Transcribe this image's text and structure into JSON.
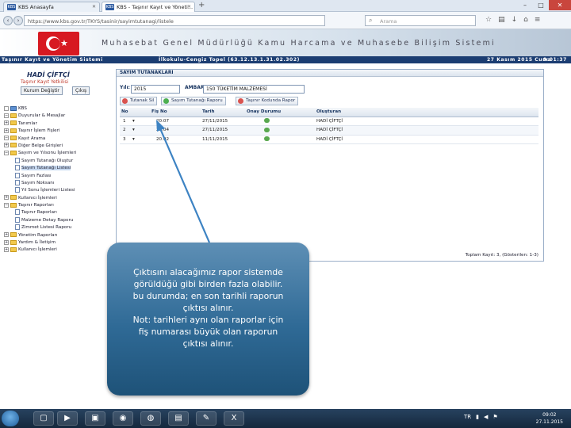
{
  "browser": {
    "tabs": [
      {
        "label": "KBS Anasayfa",
        "favicon": "KBS"
      },
      {
        "label": "KBS - Taşınır Kayıt ve Yöneti...",
        "favicon": "KBS"
      }
    ],
    "new_tab": "+",
    "url": "https://www.kbs.gov.tr/TKYS/tasinir/sayimtutanagi/listele",
    "search_placeholder": "Arama",
    "search_icon": "search-icon",
    "window_controls": {
      "minimize": "–",
      "maximize": "□",
      "close": "✕"
    }
  },
  "header": {
    "site_title": "Muhasebat Genel Müdürlüğü Kamu Harcama ve Muhasebe Bilişim Sistemi",
    "module": "Taşınır Kayıt ve Yönetim Sistemi",
    "unit": "İlkokulu-Cengiz Topel (63.12.13.1.31.02.302)",
    "date": "27 Kasım 2015 Cuma",
    "time": "9:01:37"
  },
  "user": {
    "name": "HADİ ÇİFTÇİ",
    "role": "Taşınır Kayıt Yetkilisi",
    "change_role": "Kurum Değiştir",
    "logout": "Çıkış"
  },
  "tree": [
    {
      "label": "KBS",
      "level": 0,
      "type": "root",
      "expander": ""
    },
    {
      "label": "Duyurular & Mesajlar",
      "level": 0,
      "type": "folder",
      "expander": "−"
    },
    {
      "label": "Tanımlar",
      "level": 0,
      "type": "folder",
      "expander": "+"
    },
    {
      "label": "Taşınır İşlem Fişleri",
      "level": 0,
      "type": "folder",
      "expander": "+"
    },
    {
      "label": "Kayıt Arama",
      "level": 0,
      "type": "folder",
      "expander": "−"
    },
    {
      "label": "Diğer Belge Girişleri",
      "level": 0,
      "type": "folder",
      "expander": "+"
    },
    {
      "label": "Sayım ve Yılsonu İşlemleri",
      "level": 0,
      "type": "folder",
      "expander": "−"
    },
    {
      "label": "Sayım Tutanağı Oluştur",
      "level": 1,
      "type": "doc",
      "expander": ""
    },
    {
      "label": "Sayım Tutanağı Listesi",
      "level": 1,
      "type": "doc",
      "expander": "",
      "selected": true
    },
    {
      "label": "Sayım Fazlası",
      "level": 1,
      "type": "doc",
      "expander": ""
    },
    {
      "label": "Sayım Noksanı",
      "level": 1,
      "type": "doc",
      "expander": ""
    },
    {
      "label": "Yıl Sonu İşlemleri Listesi",
      "level": 1,
      "type": "doc",
      "expander": ""
    },
    {
      "label": "Kullanıcı İşlemleri",
      "level": 0,
      "type": "folder",
      "expander": "+"
    },
    {
      "label": "Taşınır Raporları",
      "level": 0,
      "type": "folder",
      "expander": "−"
    },
    {
      "label": "Taşınır Raporları",
      "level": 1,
      "type": "doc",
      "expander": ""
    },
    {
      "label": "Malzeme Detay Raporu",
      "level": 1,
      "type": "doc",
      "expander": ""
    },
    {
      "label": "Zimmet Listesi Raporu",
      "level": 1,
      "type": "doc",
      "expander": ""
    },
    {
      "label": "Yönetim Raporları",
      "level": 0,
      "type": "folder",
      "expander": "+"
    },
    {
      "label": "Yardım & İletişim",
      "level": 0,
      "type": "folder",
      "expander": "+"
    },
    {
      "label": "Kullanıcı İşlemleri",
      "level": 0,
      "type": "folder",
      "expander": "+"
    }
  ],
  "panel": {
    "title": "SAYIM TUTANAKLARI",
    "year_label": "Yılı:",
    "year_value": "2015",
    "depot_label": "AMBAR:",
    "depot_value": "150 TÜKETİM MALZEMESİ",
    "actions": [
      {
        "label": "Tutanak Sil",
        "icon": "delete-icon",
        "color": "#d9534f"
      },
      {
        "label": "Sayım Tutanağı Raporu",
        "icon": "report-icon",
        "color": "#4caf50"
      },
      {
        "label": "Taşınır Kodunda Rapor",
        "icon": "code-report-icon",
        "color": "#d9534f"
      }
    ],
    "columns": [
      "No",
      "",
      "Fiş No",
      "Tarih",
      "Onay Durumu",
      "Oluşturan"
    ],
    "rows": [
      {
        "no": "1",
        "fis_no": "20.07",
        "tarih": "27/11/2015",
        "oluşturan": "HADİ ÇİFTÇİ"
      },
      {
        "no": "2",
        "fis_no": "20.04",
        "tarih": "27/11/2015",
        "oluşturan": "HADİ ÇİFTÇİ"
      },
      {
        "no": "3",
        "fis_no": "20.02",
        "tarih": "11/11/2015",
        "oluşturan": "HADİ ÇİFTÇİ"
      }
    ],
    "footer": "Toplam Kayıt: 3, (Gösterilen: 1-3)"
  },
  "callout": {
    "lines": [
      "Çıktısını alacağımız rapor sistemde",
      "görüldüğü gibi birden fazla olabilir.",
      "bu durumda; en son tarihli raporun",
      "çıktısı alınır.",
      "Not: tarihleri aynı olan raporlar için",
      "fiş numarası büyük olan raporun",
      "çıktısı alınır."
    ]
  },
  "taskbar": {
    "apps": [
      {
        "icon": "explorer-icon",
        "glyph": "▢"
      },
      {
        "icon": "media-player-icon",
        "glyph": "▶"
      },
      {
        "icon": "folder-icon",
        "glyph": "▣"
      },
      {
        "icon": "chrome-icon",
        "glyph": "◉"
      },
      {
        "icon": "firefox-icon",
        "glyph": "◍"
      },
      {
        "icon": "files-icon",
        "glyph": "▤"
      },
      {
        "icon": "paint-icon",
        "glyph": "✎"
      },
      {
        "icon": "excel-icon",
        "glyph": "X"
      }
    ],
    "tray_lang": "TR",
    "clock_time": "09:02",
    "clock_date": "27.11.2015"
  },
  "colors": {
    "status_bar": "#1b3d72",
    "callout_top": "#5e8fb5",
    "callout_bottom": "#1e5278",
    "flag_red": "#d71921"
  }
}
